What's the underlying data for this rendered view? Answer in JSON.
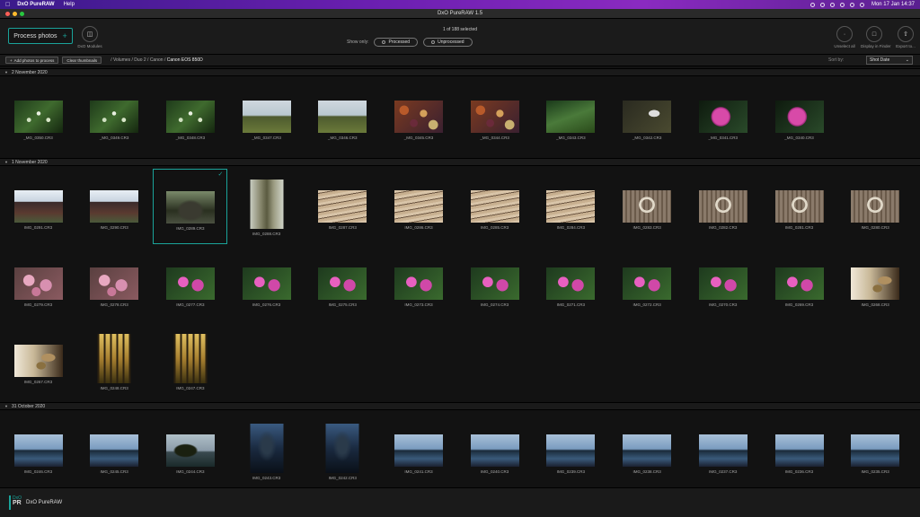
{
  "menubar": {
    "app_name": "DxO PureRAW",
    "help": "Help",
    "clock": "Mon 17 Jan  14:37"
  },
  "window": {
    "title": "DxO PureRAW 1.5"
  },
  "toolbar": {
    "process_label": "Process photos",
    "modules_label": "DxO Modules",
    "selection_status": "1 of 188 selected",
    "show_only_label": "Show only:",
    "filter_processed": "Processed",
    "filter_unprocessed": "Unprocessed",
    "unselect_all": "Unselect all",
    "display_finder": "Display in Finder",
    "export_to": "Export to..."
  },
  "pathbar": {
    "add_photos": "Add photos to process",
    "clear_thumbnails": "Clear thumbnails",
    "path": "/ Volumes / Duo 2 / Canon /",
    "path_last": "Canon EOS 850D",
    "sort_label": "Sort by:",
    "sort_value": "Shot Date"
  },
  "groups": [
    {
      "date": "2 November 2020",
      "photos": [
        {
          "name": "_MG_0350.CR3",
          "style": "t-leaf",
          "orient": "landscape"
        },
        {
          "name": "_MG_0349.CR3",
          "style": "t-leaf",
          "orient": "landscape"
        },
        {
          "name": "_MG_0348.CR3",
          "style": "t-leaf",
          "orient": "landscape"
        },
        {
          "name": "_MG_0347.CR3",
          "style": "t-field",
          "orient": "landscape"
        },
        {
          "name": "_MG_0346.CR3",
          "style": "t-field",
          "orient": "landscape"
        },
        {
          "name": "_MG_0345.CR3",
          "style": "t-nuts",
          "orient": "landscape"
        },
        {
          "name": "_MG_0344.CR3",
          "style": "t-nuts",
          "orient": "landscape"
        },
        {
          "name": "_MG_0343.CR3",
          "style": "t-forest",
          "orient": "landscape"
        },
        {
          "name": "_MG_0342.CR3",
          "style": "t-mushroom",
          "orient": "landscape"
        },
        {
          "name": "_MG_0341.CR3",
          "style": "t-flower1",
          "orient": "landscape"
        },
        {
          "name": "_MG_0340.CR3",
          "style": "t-flower1",
          "orient": "landscape"
        }
      ]
    },
    {
      "date": "1 November 2020",
      "photos": [
        {
          "name": "IMG_0291.CR3",
          "style": "t-house",
          "orient": "landscape"
        },
        {
          "name": "IMG_0290.CR3",
          "style": "t-house",
          "orient": "landscape"
        },
        {
          "name": "IMG_0289.CR3",
          "style": "t-tree-dark",
          "orient": "landscape",
          "selected": true
        },
        {
          "name": "IMG_0288.CR3",
          "style": "t-tree-tall",
          "orient": "portrait"
        },
        {
          "name": "IMG_0287.CR3",
          "style": "t-wood",
          "orient": "landscape"
        },
        {
          "name": "IMG_0286.CR3",
          "style": "t-wood",
          "orient": "landscape"
        },
        {
          "name": "IMG_0285.CR3",
          "style": "t-wood",
          "orient": "landscape"
        },
        {
          "name": "IMG_0284.CR3",
          "style": "t-wood",
          "orient": "landscape"
        },
        {
          "name": "IMG_0283.CR3",
          "style": "t-knocker",
          "orient": "landscape"
        },
        {
          "name": "IMG_0282.CR3",
          "style": "t-knocker",
          "orient": "landscape"
        },
        {
          "name": "IMG_0281.CR3",
          "style": "t-knocker",
          "orient": "landscape"
        },
        {
          "name": "IMG_0280.CR3",
          "style": "t-knocker",
          "orient": "landscape"
        },
        {
          "name": "IMG_0279.CR3",
          "style": "t-flower-pink",
          "orient": "landscape"
        },
        {
          "name": "IMG_0278.CR3",
          "style": "t-flower-pink",
          "orient": "landscape"
        },
        {
          "name": "IMG_0277.CR3",
          "style": "t-flower-mag",
          "orient": "landscape"
        },
        {
          "name": "IMG_0276.CR3",
          "style": "t-flower-mag",
          "orient": "landscape"
        },
        {
          "name": "IMG_0275.CR3",
          "style": "t-flower-mag",
          "orient": "landscape"
        },
        {
          "name": "IMG_0273.CR3",
          "style": "t-flower-mag",
          "orient": "landscape"
        },
        {
          "name": "IMG_0274.CR3",
          "style": "t-flower-mag",
          "orient": "landscape"
        },
        {
          "name": "IMG_0271.CR3",
          "style": "t-flower-mag",
          "orient": "landscape"
        },
        {
          "name": "IMG_0272.CR3",
          "style": "t-flower-mag",
          "orient": "landscape"
        },
        {
          "name": "IMG_0270.CR3",
          "style": "t-flower-mag",
          "orient": "landscape"
        },
        {
          "name": "IMG_0269.CR3",
          "style": "t-flower-mag",
          "orient": "landscape"
        },
        {
          "name": "IMG_0268.CR3",
          "style": "t-seeds",
          "orient": "landscape"
        },
        {
          "name": "IMG_0267.CR3",
          "style": "t-seeds",
          "orient": "landscape"
        },
        {
          "name": "IMG_0248.CR3",
          "style": "t-autumn",
          "orient": "portrait"
        },
        {
          "name": "IMG_0247.CR3",
          "style": "t-autumn",
          "orient": "portrait"
        }
      ]
    },
    {
      "date": "31 October 2020",
      "photos": [
        {
          "name": "IMG_0246.CR3",
          "style": "t-lake",
          "orient": "landscape"
        },
        {
          "name": "IMG_0245.CR3",
          "style": "t-lake",
          "orient": "landscape"
        },
        {
          "name": "IMG_0244.CR3",
          "style": "t-lake-tree",
          "orient": "landscape"
        },
        {
          "name": "IMG_0243.CR3",
          "style": "t-night",
          "orient": "portrait"
        },
        {
          "name": "IMG_0242.CR3",
          "style": "t-night",
          "orient": "portrait"
        },
        {
          "name": "IMG_0241.CR3",
          "style": "t-lake",
          "orient": "landscape"
        },
        {
          "name": "IMG_0240.CR3",
          "style": "t-lake",
          "orient": "landscape"
        },
        {
          "name": "IMG_0239.CR3",
          "style": "t-lake",
          "orient": "landscape"
        },
        {
          "name": "IMG_0238.CR3",
          "style": "t-lake",
          "orient": "landscape"
        },
        {
          "name": "IMG_0237.CR3",
          "style": "t-lake",
          "orient": "landscape"
        },
        {
          "name": "IMG_0236.CR3",
          "style": "t-lake",
          "orient": "landscape"
        },
        {
          "name": "IMG_0235.CR3",
          "style": "t-lake",
          "orient": "landscape"
        }
      ]
    }
  ],
  "footer": {
    "logo_small": "DxO",
    "logo_pr": "PR",
    "app_name": "DxO PureRAW"
  }
}
